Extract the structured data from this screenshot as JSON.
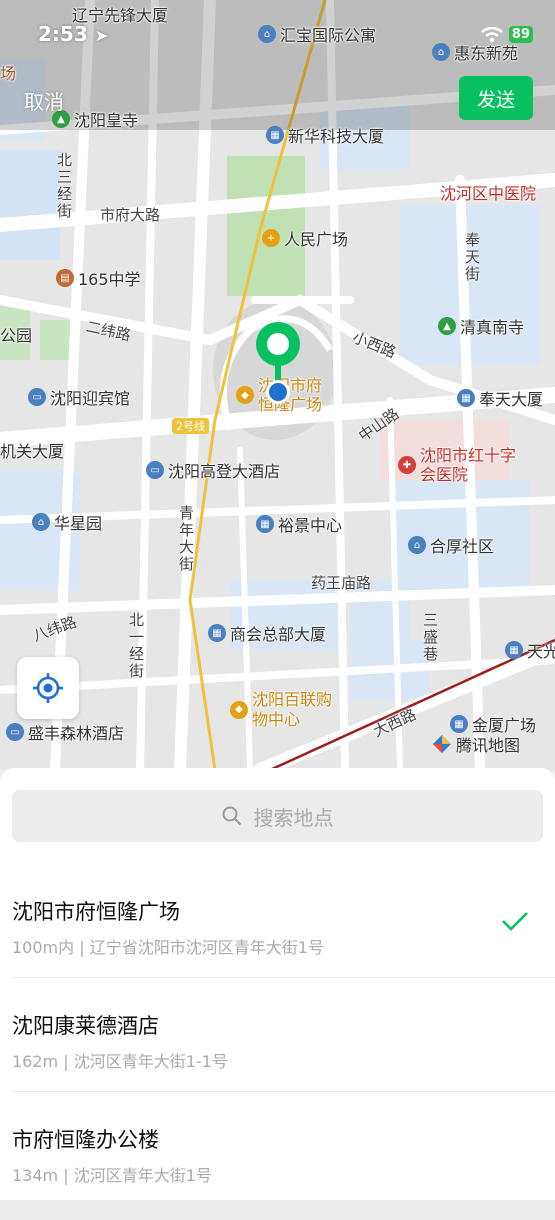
{
  "status_bar": {
    "time": "2:53",
    "battery": "89"
  },
  "header": {
    "cancel_label": "取消",
    "send_label": "发送"
  },
  "map": {
    "pois": [
      {
        "name": "辽宁先锋大厦",
        "icon": "building-icon"
      },
      {
        "name": "汇宝国际公寓",
        "icon": "home-icon"
      },
      {
        "name": "惠东新苑",
        "icon": "home-icon"
      },
      {
        "name": "沈阳皇寺",
        "icon": "temple-icon"
      },
      {
        "name": "新华科技大厦",
        "icon": "building-icon"
      },
      {
        "name": "沈河区中医院",
        "icon": "hospital-icon"
      },
      {
        "name": "人民广场",
        "icon": "plaza-icon"
      },
      {
        "name": "165中学",
        "icon": "school-icon"
      },
      {
        "name": "清真南寺",
        "icon": "temple-icon"
      },
      {
        "name": "沈阳迎宾馆",
        "icon": "hotel-icon"
      },
      {
        "name": "奉天大厦",
        "icon": "building-icon"
      },
      {
        "name": "机关大厦",
        "icon": "none"
      },
      {
        "name": "沈阳高登大酒店",
        "icon": "hotel-icon"
      },
      {
        "name": "沈阳市红十字会医院",
        "icon": "hospital-icon"
      },
      {
        "name": "华星园",
        "icon": "home-icon"
      },
      {
        "name": "裕景中心",
        "icon": "building-icon"
      },
      {
        "name": "合厚社区",
        "icon": "home-icon"
      },
      {
        "name": "商会总部大厦",
        "icon": "building-icon"
      },
      {
        "name": "沈阳百联购物中心",
        "icon": "shopping-icon"
      },
      {
        "name": "盛丰森林酒店",
        "icon": "hotel-icon"
      },
      {
        "name": "金厦广场",
        "icon": "building-icon"
      },
      {
        "name": "天光",
        "icon": "none"
      },
      {
        "name": "沈阳市府恒隆广场",
        "icon": "shopping-icon"
      },
      {
        "name": "公园",
        "icon": "none"
      },
      {
        "name": "场",
        "icon": "none"
      }
    ],
    "roads": [
      "北三经街",
      "市府大路",
      "二纬路",
      "小西路",
      "中山路",
      "奉天街",
      "青年大街",
      "药王庙路",
      "八纬路",
      "北一经街",
      "三盛巷",
      "大西路",
      "2号线"
    ],
    "brand": "腾讯地图"
  },
  "search": {
    "placeholder": "搜索地点"
  },
  "results": [
    {
      "name": "沈阳市府恒隆广场",
      "address": "100m内 | 辽宁省沈阳市沈河区青年大街1号",
      "selected": true
    },
    {
      "name": "沈阳康莱德酒店",
      "address": "162m | 沈河区青年大街1-1号",
      "selected": false
    },
    {
      "name": "市府恒隆办公楼",
      "address": "134m | 沈河区青年大街1号",
      "selected": false
    }
  ],
  "colors": {
    "accent": "#07c160",
    "pin": "#07c160",
    "user_dot": "#1f6fd0",
    "metro_line": "#f0c23a",
    "rail_line": "#9a1e1e"
  }
}
